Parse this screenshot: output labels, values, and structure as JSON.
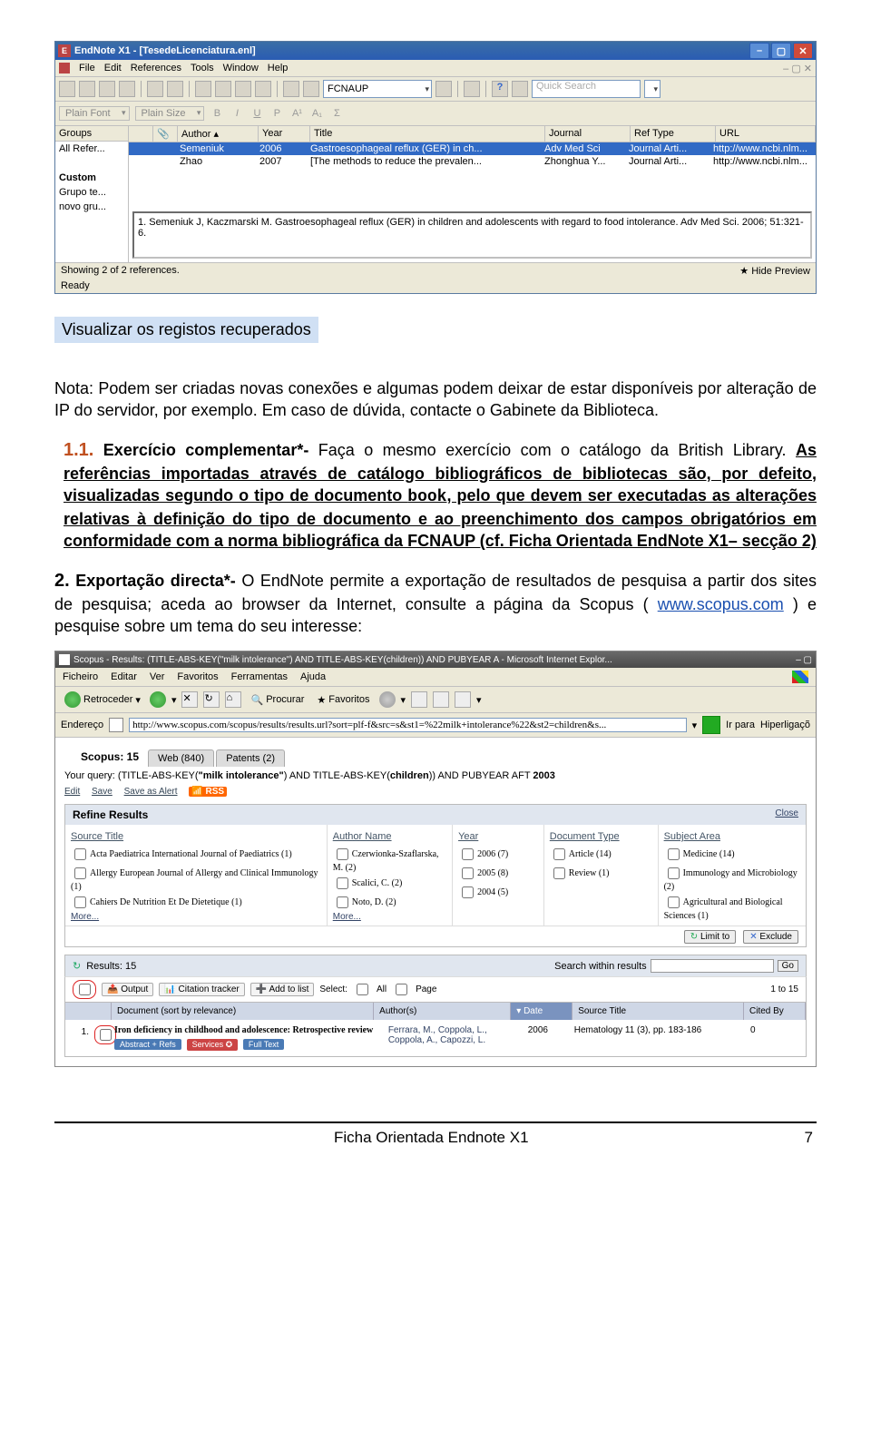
{
  "endnote": {
    "title": "EndNote X1 - [TesedeLicenciatura.enl]",
    "subbar_items": [
      "File",
      "Edit",
      "References",
      "Tools",
      "Window",
      "Help"
    ],
    "style_select": "FCNAUP",
    "quick_search": "Quick Search",
    "font_label": "Plain Font",
    "size_label": "Plain Size",
    "fmt_buttons": [
      "B",
      "I",
      "U",
      "P",
      "A¹",
      "A₁",
      "Σ"
    ],
    "groups_header": "Groups",
    "groups": [
      "All Refer...",
      "",
      "Custom",
      "Grupo te...",
      "novo gru..."
    ],
    "columns": [
      "",
      "",
      "Author",
      "Year",
      "Title",
      "Journal",
      "Ref Type",
      "URL"
    ],
    "col_widths": [
      "18px",
      "18px",
      "80px",
      "48px",
      "250px",
      "85px",
      "85px",
      "150px"
    ],
    "rows": [
      {
        "author": "Semeniuk",
        "year": "2006",
        "title": "Gastroesophageal reflux (GER) in ch...",
        "journal": "Adv Med Sci",
        "reftype": "Journal Arti...",
        "url": "http://www.ncbi.nlm...",
        "sel": true
      },
      {
        "author": "Zhao",
        "year": "2007",
        "title": "[The methods to reduce the prevalen...",
        "journal": "Zhonghua Y...",
        "reftype": "Journal Arti...",
        "url": "http://www.ncbi.nlm...",
        "sel": false
      }
    ],
    "preview": "1.    Semeniuk J, Kaczmarski M. Gastroesophageal reflux (GER) in children and adolescents with regard to food intolerance. Adv Med Sci. 2006; 51:321-6.",
    "status_left": "Showing 2 of 2 references.",
    "status_ready": "Ready",
    "hide_preview": "Hide Preview"
  },
  "doc": {
    "highlight": "Visualizar os registos recuperados",
    "note": "Nota: Podem ser criadas novas conexões e algumas podem deixar de estar disponíveis por alteração de IP do servidor, por exemplo. Em caso de dúvida, contacte o Gabinete da Biblioteca.",
    "ex1_num": "1.1.",
    "ex1_a": "Exercício complementar*- ",
    "ex1_b": "Faça o mesmo exercício com o catálogo da British Library. ",
    "ex1_ul1": "As referências importadas através de catálogo bibliográficos de bibliotecas são, por defeito, visualizadas segundo o tipo de documento ",
    "ex1_code": "book",
    "ex1_ul2": ", pelo que devem ser executadas as alterações relativas à definição do tipo de documento e ao preenchimento dos campos obrigatórios em conformidade com a norma bibliográfica da FCNAUP (cf. Ficha Orientada EndNote X1– secção 2)",
    "ex2_num": "2.",
    "ex2_bold": " Exportação directa*-",
    "ex2_rest": "  O EndNote permite a exportação de resultados de pesquisa a partir dos sites de pesquisa; aceda ao browser da Internet, consulte a página da Scopus (",
    "ex2_link": "www.scopus.com",
    "ex2_end": ") e pesquise sobre um tema do seu interesse:"
  },
  "scopus": {
    "title": "Scopus - Results: (TITLE-ABS-KEY(\"milk intolerance\") AND TITLE-ABS-KEY(children)) AND PUBYEAR A - Microsoft Internet Explor...",
    "menu": [
      "Ficheiro",
      "Editar",
      "Ver",
      "Favoritos",
      "Ferramentas",
      "Ajuda"
    ],
    "back": "Retroceder",
    "search": "Procurar",
    "fav": "Favoritos",
    "addr_label": "Endereço",
    "addr": "http://www.scopus.com/scopus/results/results.url?sort=plf-f&src=s&st1=%22milk+intolerance%22&st2=children&s...",
    "go": "Ir para",
    "links": "Hiperligaçõ",
    "tabs_count": "Scopus: 15",
    "tabs": [
      {
        "l": "Web (840)"
      },
      {
        "l": "Patents (2)"
      }
    ],
    "query_pre": "Your query: (TITLE-ABS-KEY(",
    "q1": "\"milk intolerance\"",
    "mid": ") AND TITLE-ABS-KEY(",
    "q2": "children",
    "post": ")) AND PUBYEAR AFT ",
    "q3": "2003",
    "links_row": [
      "Edit",
      "Save",
      "Save as Alert"
    ],
    "rss": "RSS",
    "refine_title": "Refine Results",
    "close": "Close",
    "refine_cols": [
      "Source Title",
      "Author Name",
      "Year",
      "Document Type",
      "Subject Area"
    ],
    "src_items": [
      "Acta Paediatrica International Journal of Paediatrics (1)",
      "Allergy European Journal of Allergy and Clinical Immunology (1)",
      "Cahiers De Nutrition Et De Dietetique (1)"
    ],
    "auth_items": [
      "Czerwionka-Szaflarska, M. (2)",
      "Scalici, C. (2)",
      "Noto, D. (2)"
    ],
    "yr_items": [
      "2006 (7)",
      "2005 (8)",
      "2004 (5)"
    ],
    "dt_items": [
      "Article (14)",
      "Review (1)"
    ],
    "sa_items": [
      "Medicine (14)",
      "Immunology and Microbiology (2)",
      "Agricultural and Biological Sciences (1)"
    ],
    "more": "More...",
    "limit": "Limit to",
    "exclude": "Exclude",
    "res_label": "Results: 15",
    "swr": "Search within results",
    "go_btn": "Go",
    "output": "Output",
    "ct": "Citation tracker",
    "addlist": "Add to list",
    "select": "Select:",
    "all": "All",
    "page": "Page",
    "range": "1 to 15",
    "th": [
      "Document (sort by relevance)",
      "Author(s)",
      "Date",
      "Source Title",
      "Cited By"
    ],
    "th_w": [
      "280px",
      "120px",
      "55px",
      "160px",
      "55px"
    ],
    "row1_num": "1.",
    "row1_doc": "Iron deficiency in childhood and adolescence: Retrospective review",
    "row1_btns": [
      "Abstract + Refs",
      "Services",
      "Full Text"
    ],
    "row1_auth": "Ferrara, M., Coppola, L., Coppola, A., Capozzi, L.",
    "row1_yr": "2006",
    "row1_src": "Hematology 11 (3), pp. 183-186",
    "row1_cited": "0"
  },
  "footer": {
    "center": "Ficha Orientada Endnote X1",
    "right": "7"
  }
}
